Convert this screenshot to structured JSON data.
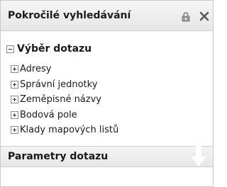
{
  "header": {
    "title": "Pokročilé vyhledávání",
    "lock_icon": "lock-icon",
    "close_icon": "close-icon"
  },
  "query_selection": {
    "title": "Výběr dotazu",
    "state": "expanded",
    "items": [
      {
        "label": "Adresy"
      },
      {
        "label": "Správní jednotky"
      },
      {
        "label": "Zeměpisné názvy"
      },
      {
        "label": "Bodová pole"
      },
      {
        "label": "Klady mapových listů"
      }
    ]
  },
  "parameters": {
    "title": "Parametry dotazu",
    "arrow_icon": "arrow-down-icon"
  }
}
